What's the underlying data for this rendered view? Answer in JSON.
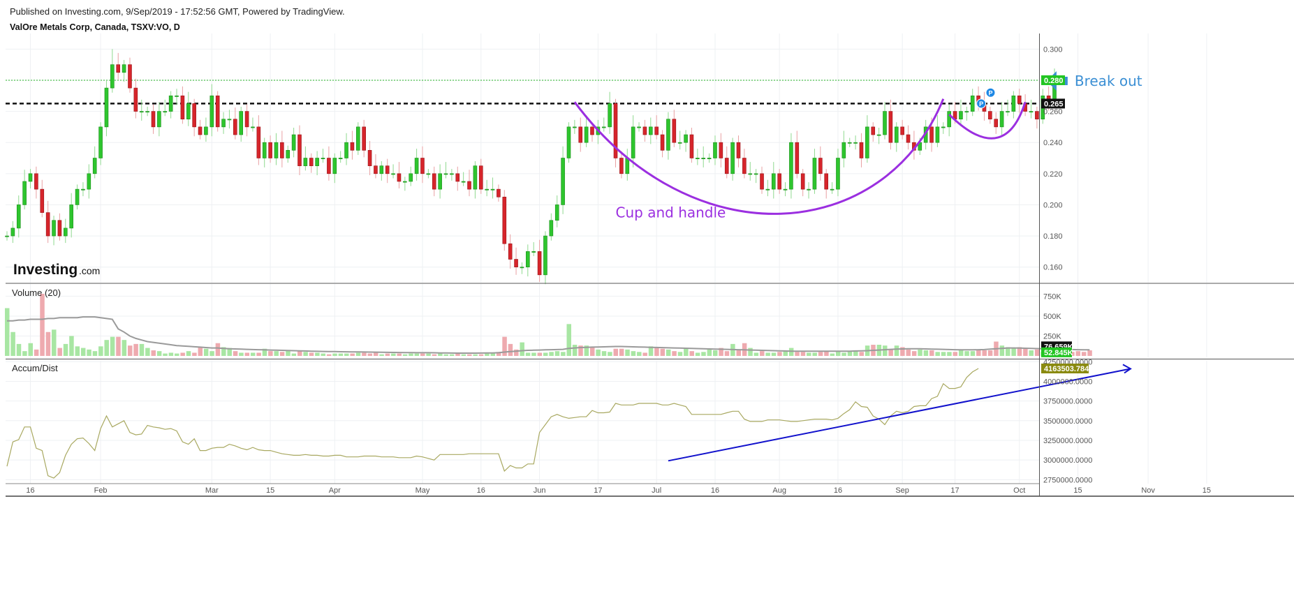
{
  "header": {
    "published": "Published on Investing.com, 9/Sep/2019 - 17:52:56 GMT, Powered by TradingView.",
    "symbol": "ValOre Metals Corp, Canada, TSXV:VO, D"
  },
  "logo": {
    "main": "Investing",
    "suffix": ".com"
  },
  "colors": {
    "up": "#2ec52e",
    "down": "#d6252b",
    "up_vol": "#a8e6a3",
    "down_vol": "#eeaaaf",
    "support_line": "#111111",
    "breakout_line": "#22b022",
    "cup_curve": "#9b2fe0",
    "trend_arrow": "#1111cc",
    "ad_line": "#a8a860",
    "volume_ma": "#9a9a9a",
    "arrow_blue": "#3b8fd4"
  },
  "chart_data": [
    {
      "type": "candlestick",
      "pane": "price",
      "ylim": [
        0.15,
        0.31
      ],
      "yticks": [
        "0.300",
        "0.280",
        "0.260",
        "0.240",
        "0.220",
        "0.200",
        "0.180",
        "0.160"
      ],
      "xtick_labels": [
        "16",
        "Feb",
        "Mar",
        "15",
        "Apr",
        "May",
        "16",
        "Jun",
        "17",
        "Jul",
        "16",
        "Aug",
        "16",
        "Sep",
        "17",
        "Oct",
        "15",
        "Nov",
        "15"
      ],
      "x_index_ticks": [
        4,
        16,
        35,
        45,
        56,
        71,
        81,
        91,
        101,
        111,
        121,
        132,
        142,
        153,
        162,
        173,
        183,
        195,
        205
      ],
      "closes": [
        0.18,
        0.185,
        0.2,
        0.215,
        0.22,
        0.21,
        0.195,
        0.18,
        0.19,
        0.18,
        0.185,
        0.2,
        0.21,
        0.21,
        0.22,
        0.23,
        0.25,
        0.275,
        0.29,
        0.285,
        0.29,
        0.275,
        0.26,
        0.26,
        0.26,
        0.25,
        0.26,
        0.26,
        0.27,
        0.27,
        0.255,
        0.265,
        0.25,
        0.245,
        0.25,
        0.27,
        0.25,
        0.255,
        0.255,
        0.245,
        0.26,
        0.25,
        0.25,
        0.23,
        0.24,
        0.23,
        0.24,
        0.23,
        0.235,
        0.245,
        0.225,
        0.23,
        0.225,
        0.23,
        0.23,
        0.22,
        0.23,
        0.23,
        0.24,
        0.235,
        0.25,
        0.235,
        0.225,
        0.22,
        0.225,
        0.22,
        0.22,
        0.215,
        0.215,
        0.22,
        0.23,
        0.22,
        0.22,
        0.21,
        0.22,
        0.22,
        0.22,
        0.215,
        0.215,
        0.21,
        0.225,
        0.21,
        0.21,
        0.21,
        0.205,
        0.175,
        0.165,
        0.16,
        0.16,
        0.17,
        0.17,
        0.155,
        0.18,
        0.19,
        0.2,
        0.23,
        0.25,
        0.25,
        0.24,
        0.25,
        0.245,
        0.25,
        0.25,
        0.265,
        0.23,
        0.22,
        0.23,
        0.25,
        0.25,
        0.245,
        0.25,
        0.245,
        0.235,
        0.255,
        0.24,
        0.24,
        0.245,
        0.23,
        0.23,
        0.23,
        0.23,
        0.24,
        0.23,
        0.22,
        0.24,
        0.23,
        0.22,
        0.22,
        0.22,
        0.21,
        0.21,
        0.22,
        0.21,
        0.21,
        0.24,
        0.22,
        0.21,
        0.21,
        0.23,
        0.22,
        0.21,
        0.21,
        0.23,
        0.24,
        0.24,
        0.24,
        0.23,
        0.25,
        0.245,
        0.245,
        0.26,
        0.24,
        0.25,
        0.245,
        0.24,
        0.235,
        0.24,
        0.25,
        0.24,
        0.25,
        0.25,
        0.26,
        0.255,
        0.26,
        0.26,
        0.27,
        0.265,
        0.26,
        0.255,
        0.25,
        0.26,
        0.26,
        0.27,
        0.265,
        0.26,
        0.26,
        0.255,
        0.27,
        0.265,
        0.28
      ],
      "reference_lines": [
        {
          "label": "0.280",
          "value": 0.28
        },
        {
          "label": "0.265",
          "value": 0.265
        }
      ],
      "annotations": [
        "Break out",
        "Cup and handle"
      ],
      "markers": [
        "P",
        "P"
      ]
    },
    {
      "type": "bar",
      "pane": "volume",
      "title": "Volume (20)",
      "ylim": [
        0,
        850000
      ],
      "yticks": [
        "750K",
        "500K",
        "250K"
      ],
      "labels": [
        "76.659K",
        "52.845K"
      ],
      "values": [
        600000,
        300000,
        150000,
        60000,
        160000,
        80000,
        780000,
        300000,
        330000,
        100000,
        150000,
        250000,
        120000,
        100000,
        80000,
        60000,
        120000,
        200000,
        240000,
        240000,
        200000,
        130000,
        150000,
        150000,
        100000,
        70000,
        60000,
        30000,
        40000,
        30000,
        40000,
        60000,
        40000,
        110000,
        90000,
        60000,
        160000,
        110000,
        100000,
        60000,
        40000,
        40000,
        40000,
        40000,
        90000,
        60000,
        60000,
        50000,
        70000,
        30000,
        60000,
        50000,
        40000,
        40000,
        30000,
        20000,
        30000,
        30000,
        30000,
        30000,
        40000,
        40000,
        30000,
        40000,
        20000,
        30000,
        30000,
        30000,
        20000,
        30000,
        30000,
        30000,
        30000,
        20000,
        30000,
        20000,
        20000,
        30000,
        20000,
        20000,
        20000,
        20000,
        30000,
        30000,
        50000,
        240000,
        150000,
        80000,
        170000,
        40000,
        40000,
        40000,
        40000,
        50000,
        60000,
        50000,
        400000,
        140000,
        130000,
        130000,
        110000,
        80000,
        60000,
        50000,
        90000,
        90000,
        80000,
        60000,
        50000,
        40000,
        120000,
        100000,
        90000,
        80000,
        60000,
        50000,
        100000,
        60000,
        40000,
        50000,
        80000,
        70000,
        100000,
        60000,
        150000,
        80000,
        160000,
        100000,
        40000,
        60000,
        40000,
        40000,
        50000,
        60000,
        100000,
        50000,
        50000,
        40000,
        40000,
        50000,
        60000,
        30000,
        60000,
        40000,
        60000,
        70000,
        50000,
        130000,
        140000,
        140000,
        130000,
        80000,
        130000,
        110000,
        80000,
        60000,
        80000,
        70000,
        70000,
        50000,
        50000,
        50000,
        50000,
        70000,
        60000,
        60000,
        70000,
        70000,
        70000,
        180000,
        130000,
        110000,
        100000,
        110000,
        90000,
        70000,
        80000,
        50000,
        70000,
        70000,
        60000,
        60000,
        50000,
        60000,
        50000,
        70000
      ],
      "ma_values": [
        440000,
        440000,
        450000,
        450000,
        460000,
        460000,
        460000,
        470000,
        470000,
        480000,
        480000,
        480000,
        480000,
        490000,
        490000,
        490000,
        480000,
        470000,
        460000,
        340000,
        300000,
        250000,
        220000,
        200000,
        180000,
        170000,
        160000,
        150000,
        140000,
        130000,
        125000,
        120000,
        115000,
        110000,
        105000,
        100000,
        100000,
        95000,
        90000,
        88000,
        85000,
        82000,
        80000,
        78000,
        76000,
        74000,
        72000,
        70000,
        68000,
        66000,
        64000,
        62000,
        60000,
        58000,
        56000,
        55000,
        54000,
        53000,
        52000,
        51000,
        50000,
        49000,
        48000,
        47000,
        46000,
        45000,
        44000,
        43000,
        42000,
        41000,
        40000,
        40000,
        40000,
        39000,
        38000,
        37000,
        36000,
        35000,
        35000,
        35000,
        35000,
        36000,
        37000,
        38000,
        40000,
        48000,
        55000,
        60000,
        66000,
        70000,
        72000,
        74000,
        76000,
        78000,
        80000,
        82000,
        95000,
        100000,
        105000,
        108000,
        110000,
        112000,
        114000,
        116000,
        118000,
        118000,
        116000,
        114000,
        112000,
        110000,
        108000,
        106000,
        104000,
        102000,
        100000,
        98000,
        96000,
        94000,
        92000,
        90000,
        88000,
        86000,
        84000,
        82000,
        80000,
        78000,
        76000,
        74000,
        72000,
        70000,
        68000,
        66000,
        64000,
        62000,
        60000,
        60000,
        60000,
        60000,
        60000,
        60000,
        60000,
        60000,
        60000,
        60000,
        60000,
        62000,
        64000,
        66000,
        70000,
        74000,
        78000,
        82000,
        86000,
        88000,
        90000,
        90000,
        90000,
        88000,
        86000,
        84000,
        82000,
        80000,
        78000,
        76000,
        76000,
        76000,
        78000,
        80000,
        85000,
        90000,
        95000,
        100000,
        100000,
        98000,
        96000,
        94000,
        92000,
        90000,
        88000,
        86000,
        84000,
        82000,
        80000,
        78000,
        77000,
        76659
      ]
    },
    {
      "type": "line",
      "pane": "accumulation-distribution",
      "title": "Accum/Dist",
      "ylim": [
        2700000,
        4270000
      ],
      "yticks": [
        "4250000.0000",
        "4000000.0000",
        "3750000.0000",
        "3500000.0000",
        "3250000.0000",
        "3000000.0000",
        "2750000.0000"
      ],
      "labels": [
        "4163503.7843"
      ],
      "values": [
        2920000,
        3230000,
        3260000,
        3420000,
        3420000,
        3150000,
        3120000,
        2800000,
        2770000,
        2840000,
        3060000,
        3200000,
        3270000,
        3280000,
        3210000,
        3120000,
        3400000,
        3560000,
        3420000,
        3460000,
        3500000,
        3350000,
        3320000,
        3330000,
        3440000,
        3420000,
        3410000,
        3390000,
        3400000,
        3370000,
        3230000,
        3200000,
        3270000,
        3120000,
        3120000,
        3150000,
        3160000,
        3160000,
        3200000,
        3180000,
        3150000,
        3130000,
        3160000,
        3130000,
        3120000,
        3120000,
        3100000,
        3080000,
        3070000,
        3060000,
        3060000,
        3070000,
        3060000,
        3060000,
        3050000,
        3050000,
        3060000,
        3060000,
        3040000,
        3040000,
        3040000,
        3050000,
        3050000,
        3050000,
        3040000,
        3040000,
        3040000,
        3030000,
        3030000,
        3030000,
        3050000,
        3040000,
        3020000,
        3000000,
        3070000,
        3070000,
        3070000,
        3070000,
        3070000,
        3080000,
        3080000,
        3080000,
        3080000,
        3080000,
        3080000,
        2860000,
        2930000,
        2900000,
        2900000,
        2950000,
        2950000,
        3350000,
        3450000,
        3550000,
        3580000,
        3550000,
        3530000,
        3540000,
        3550000,
        3550000,
        3630000,
        3600000,
        3600000,
        3610000,
        3720000,
        3700000,
        3700000,
        3700000,
        3720000,
        3720000,
        3720000,
        3720000,
        3700000,
        3700000,
        3720000,
        3700000,
        3680000,
        3580000,
        3580000,
        3580000,
        3580000,
        3580000,
        3580000,
        3600000,
        3620000,
        3620000,
        3520000,
        3490000,
        3490000,
        3490000,
        3510000,
        3510000,
        3510000,
        3500000,
        3490000,
        3490000,
        3500000,
        3510000,
        3520000,
        3520000,
        3520000,
        3510000,
        3530000,
        3590000,
        3640000,
        3740000,
        3680000,
        3670000,
        3560000,
        3520000,
        3450000,
        3560000,
        3620000,
        3600000,
        3620000,
        3680000,
        3690000,
        3690000,
        3780000,
        3810000,
        3970000,
        3910000,
        3910000,
        3930000,
        4050000,
        4120000,
        4163504
      ],
      "trend_arrow": {
        "from": {
          "index": 113,
          "value": 2990000
        },
        "to": {
          "index": 192,
          "value": 4160000
        }
      }
    }
  ]
}
